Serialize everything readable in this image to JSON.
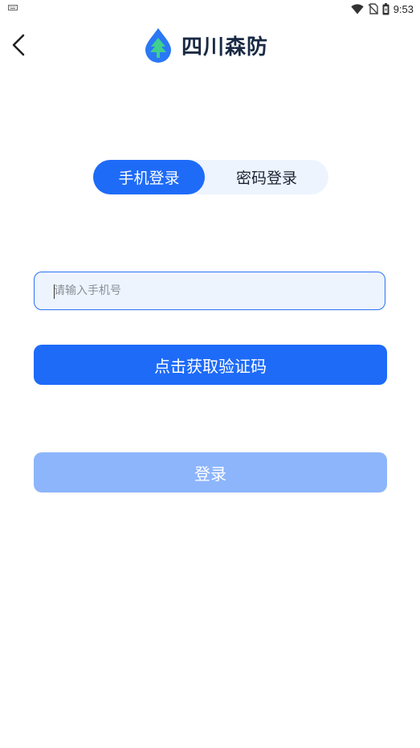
{
  "status_bar": {
    "time": "9:53",
    "icons": [
      "keyboard-icon",
      "wifi-icon",
      "no-sim-icon",
      "battery-icon"
    ]
  },
  "header": {
    "back_icon": "chevron-left-icon",
    "logo_icon": "water-drop-tree-icon",
    "title": "四川森防"
  },
  "login_tabs": {
    "items": [
      {
        "label": "手机登录",
        "active": true
      },
      {
        "label": "密码登录",
        "active": false
      }
    ]
  },
  "phone_input": {
    "placeholder": "请输入手机号",
    "value": ""
  },
  "get_code_button": {
    "label": "点击获取验证码"
  },
  "login_button": {
    "label": "登录",
    "enabled": false
  },
  "colors": {
    "primary": "#1e6bf8",
    "primary_disabled": "#8db5fb",
    "tab_background": "#eef4fe",
    "title_text": "#1a2a44",
    "logo_drop": "#2a78f5",
    "logo_tree": "#3fcf8e"
  }
}
